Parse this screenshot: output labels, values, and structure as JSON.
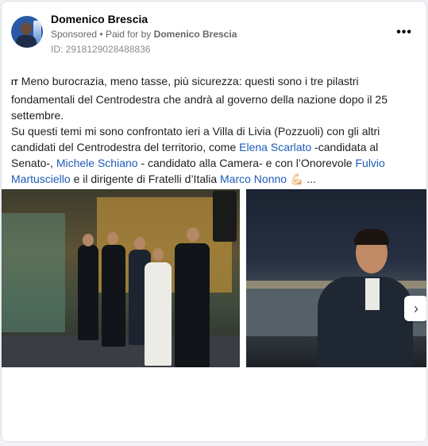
{
  "post": {
    "author": "Domenico Brescia",
    "sponsored_label": "Sponsored",
    "paid_for_prefix": "Paid for by",
    "paid_for_by": "Domenico Brescia",
    "separator": "•",
    "ad_id": "ID: 2918129028488836",
    "more_icon": "•••"
  },
  "body": {
    "flag_emoji": "IT",
    "line1": "Meno burocrazia, meno tasse, più sicurezza: questi sono i tre pilastri fondamentali del Centrodestra che andrà al governo della nazione dopo il 25 settembre.",
    "line2_a": "Su questi temi mi sono confrontato ieri a Villa di Livia (Pozzuoli) con gli altri candidati del Centrodestra del territorio, come ",
    "link1": "Elena Scarlato",
    "line2_b": " -candidata al Senato-, ",
    "link2": "Michele Schiano",
    "line2_c": " - candidato alla Camera- e con l’Onorevole ",
    "link3": "Fulvio Martusciello",
    "line2_d": " e il dirigente di Fratelli d’Italia ",
    "link4": "Marco Nonno",
    "line2_e": " 💪🏻 ..."
  },
  "carousel": {
    "next_icon": "›"
  }
}
